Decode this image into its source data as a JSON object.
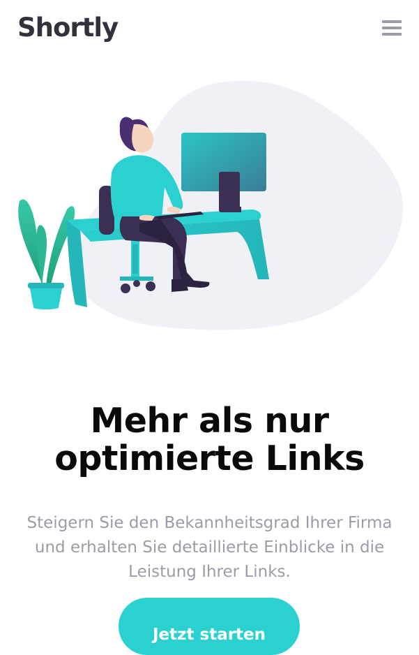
{
  "header": {
    "logo": "Shortly",
    "menu_icon": "hamburger-menu-icon"
  },
  "hero": {
    "illustration": "person-working-at-desk-illustration",
    "headline": "Mehr als nur optimierte Links",
    "subtext": "Steigern Sie den Bekannheitsgrad Ihrer Firma und erhalten Sie detaillierte Einblicke in die Leistung Ihrer Links.",
    "cta_label": "Jetzt starten"
  },
  "colors": {
    "primary": "#2bd0d0",
    "dark_violet": "#3b3054",
    "text_gray": "#9e9aa8",
    "blob": "#f0f1f6"
  }
}
